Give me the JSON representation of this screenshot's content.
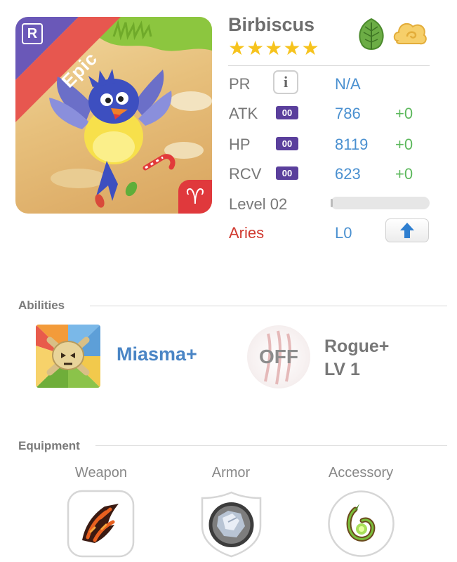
{
  "character": {
    "name": "Birbiscus",
    "rarity": "Epic",
    "rank_badge": "R",
    "stars": 5,
    "elements": [
      "leaf-icon",
      "cloud-swirl-icon"
    ],
    "zodiac_symbol": "♈"
  },
  "stats": {
    "pr": {
      "label": "PR",
      "value": "N/A"
    },
    "atk": {
      "label": "ATK",
      "badge": "00",
      "value": "786",
      "bonus": "+0"
    },
    "hp": {
      "label": "HP",
      "badge": "00",
      "value": "8119",
      "bonus": "+0"
    },
    "rcv": {
      "label": "RCV",
      "badge": "00",
      "value": "623",
      "bonus": "+0"
    },
    "level": {
      "label": "Level 02",
      "exp_fraction": 0.0
    },
    "zodiac": {
      "label": "Aries",
      "value": "L0"
    }
  },
  "abilities": {
    "title": "Abilities",
    "ability_name": "Miasma+",
    "skill_state": "OFF",
    "skill_name": "Rogue+",
    "skill_level": "LV 1"
  },
  "equipment": {
    "title": "Equipment",
    "slots": [
      {
        "label": "Weapon"
      },
      {
        "label": "Armor"
      },
      {
        "label": "Accessory"
      }
    ]
  },
  "colors": {
    "accent_blue": "#4a90d0",
    "bonus_green": "#5cb85c",
    "zodiac_red": "#d0392f",
    "star_gold": "#f6c31d",
    "badge_purple": "#5a3f9c"
  }
}
